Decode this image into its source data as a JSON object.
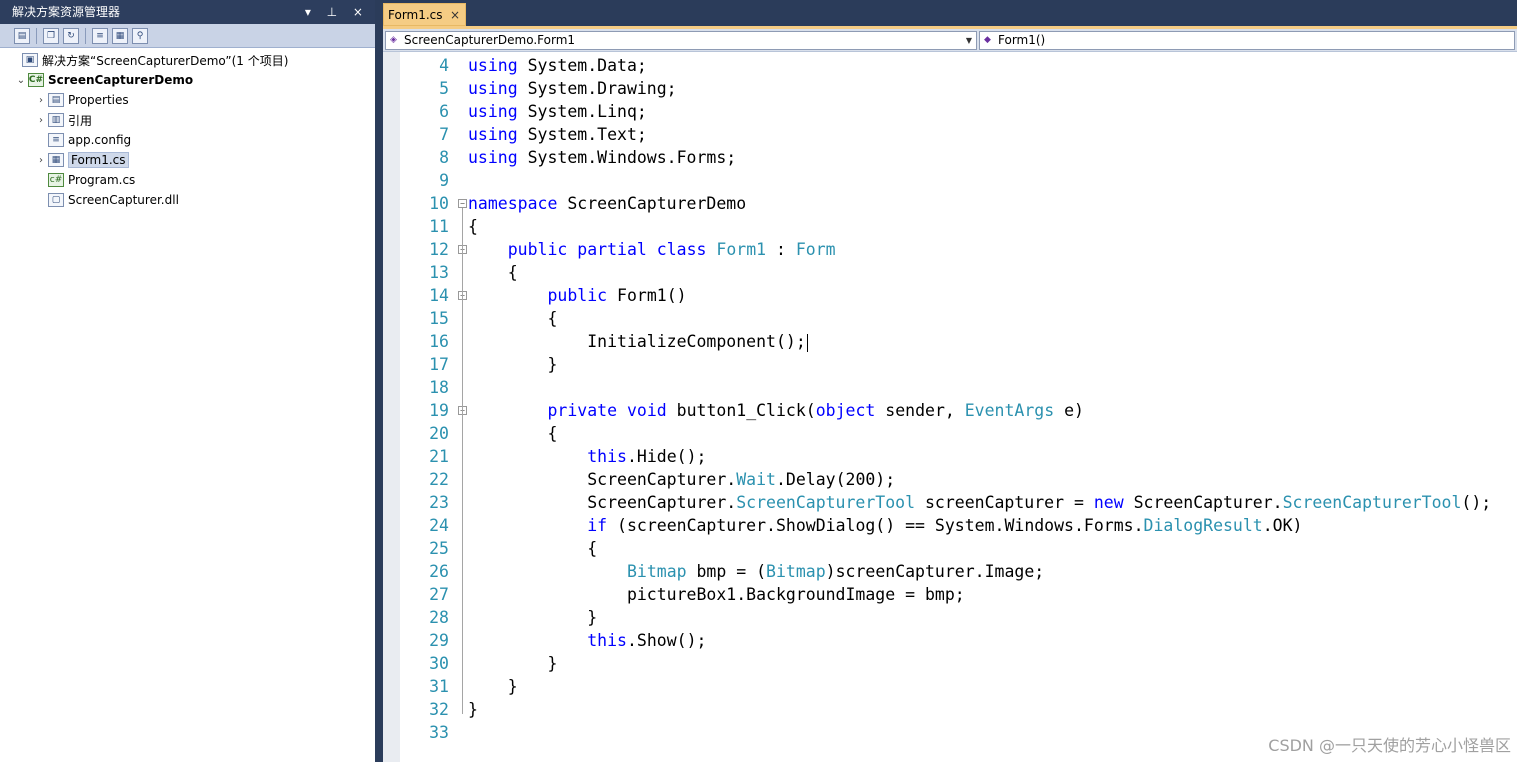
{
  "solution_explorer": {
    "title": "解决方案资源管理器",
    "title_controls": "▾ ⊥ ×",
    "solution_label": "解决方案“ScreenCapturerDemo”(1 个项目)",
    "project_label": "ScreenCapturerDemo",
    "items": [
      {
        "label": "Properties",
        "expandable": true,
        "icon": "properties-icon"
      },
      {
        "label": "引用",
        "expandable": true,
        "icon": "references-icon"
      },
      {
        "label": "app.config",
        "expandable": false,
        "icon": "config-file-icon"
      },
      {
        "label": "Form1.cs",
        "expandable": true,
        "icon": "form-icon",
        "selected": true
      },
      {
        "label": "Program.cs",
        "expandable": false,
        "icon": "csharp-file-icon"
      },
      {
        "label": "ScreenCapturer.dll",
        "expandable": false,
        "icon": "dll-file-icon"
      }
    ]
  },
  "editor": {
    "tab_label": "Form1.cs",
    "tab_close": "×",
    "type_dropdown": "ScreenCapturerDemo.Form1",
    "member_dropdown": "Form1()",
    "lines": [
      {
        "n": "4",
        "segs": [
          [
            "kw",
            "using"
          ],
          [
            "t",
            " System.Data;"
          ]
        ]
      },
      {
        "n": "5",
        "segs": [
          [
            "kw",
            "using"
          ],
          [
            "t",
            " System.Drawing;"
          ]
        ]
      },
      {
        "n": "6",
        "segs": [
          [
            "kw",
            "using"
          ],
          [
            "t",
            " System.Linq;"
          ]
        ]
      },
      {
        "n": "7",
        "segs": [
          [
            "kw",
            "using"
          ],
          [
            "t",
            " System.Text;"
          ]
        ]
      },
      {
        "n": "8",
        "segs": [
          [
            "kw",
            "using"
          ],
          [
            "t",
            " System.Windows.Forms;"
          ]
        ]
      },
      {
        "n": "9",
        "segs": []
      },
      {
        "n": "10",
        "fold": true,
        "segs": [
          [
            "kw",
            "namespace"
          ],
          [
            "t",
            " ScreenCapturerDemo"
          ]
        ]
      },
      {
        "n": "11",
        "segs": [
          [
            "t",
            "{"
          ]
        ]
      },
      {
        "n": "12",
        "fold": true,
        "segs": [
          [
            "t",
            "    "
          ],
          [
            "kw",
            "public"
          ],
          [
            "t",
            " "
          ],
          [
            "kw",
            "partial"
          ],
          [
            "t",
            " "
          ],
          [
            "kw",
            "class"
          ],
          [
            "t",
            " "
          ],
          [
            "ty",
            "Form1"
          ],
          [
            "t",
            " : "
          ],
          [
            "ty",
            "Form"
          ]
        ]
      },
      {
        "n": "13",
        "segs": [
          [
            "t",
            "    {"
          ]
        ]
      },
      {
        "n": "14",
        "fold": true,
        "segs": [
          [
            "t",
            "        "
          ],
          [
            "kw",
            "public"
          ],
          [
            "t",
            " Form1()"
          ]
        ]
      },
      {
        "n": "15",
        "segs": [
          [
            "t",
            "        {"
          ]
        ]
      },
      {
        "n": "16",
        "caret": true,
        "segs": [
          [
            "t",
            "            InitializeComponent();"
          ]
        ]
      },
      {
        "n": "17",
        "segs": [
          [
            "t",
            "        }"
          ]
        ]
      },
      {
        "n": "18",
        "segs": []
      },
      {
        "n": "19",
        "fold": true,
        "segs": [
          [
            "t",
            "        "
          ],
          [
            "kw",
            "private"
          ],
          [
            "t",
            " "
          ],
          [
            "kw",
            "void"
          ],
          [
            "t",
            " button1_Click("
          ],
          [
            "kw",
            "object"
          ],
          [
            "t",
            " sender, "
          ],
          [
            "ty",
            "EventArgs"
          ],
          [
            "t",
            " e)"
          ]
        ]
      },
      {
        "n": "20",
        "segs": [
          [
            "t",
            "        {"
          ]
        ]
      },
      {
        "n": "21",
        "segs": [
          [
            "t",
            "            "
          ],
          [
            "kw",
            "this"
          ],
          [
            "t",
            ".Hide();"
          ]
        ]
      },
      {
        "n": "22",
        "segs": [
          [
            "t",
            "            ScreenCapturer."
          ],
          [
            "ty",
            "Wait"
          ],
          [
            "t",
            ".Delay(200);"
          ]
        ]
      },
      {
        "n": "23",
        "segs": [
          [
            "t",
            "            ScreenCapturer."
          ],
          [
            "ty",
            "ScreenCapturerTool"
          ],
          [
            "t",
            " screenCapturer = "
          ],
          [
            "kw",
            "new"
          ],
          [
            "t",
            " ScreenCapturer."
          ],
          [
            "ty",
            "ScreenCapturerTool"
          ],
          [
            "t",
            "();"
          ]
        ]
      },
      {
        "n": "24",
        "segs": [
          [
            "t",
            "            "
          ],
          [
            "kw",
            "if"
          ],
          [
            "t",
            " (screenCapturer.ShowDialog() == System.Windows.Forms."
          ],
          [
            "ty",
            "DialogResult"
          ],
          [
            "t",
            ".OK)"
          ]
        ]
      },
      {
        "n": "25",
        "segs": [
          [
            "t",
            "            {"
          ]
        ]
      },
      {
        "n": "26",
        "segs": [
          [
            "t",
            "                "
          ],
          [
            "ty",
            "Bitmap"
          ],
          [
            "t",
            " bmp = ("
          ],
          [
            "ty",
            "Bitmap"
          ],
          [
            "t",
            ")screenCapturer.Image;"
          ]
        ]
      },
      {
        "n": "27",
        "segs": [
          [
            "t",
            "                pictureBox1.BackgroundImage = bmp;"
          ]
        ]
      },
      {
        "n": "28",
        "segs": [
          [
            "t",
            "            }"
          ]
        ]
      },
      {
        "n": "29",
        "segs": [
          [
            "t",
            "            "
          ],
          [
            "kw",
            "this"
          ],
          [
            "t",
            ".Show();"
          ]
        ]
      },
      {
        "n": "30",
        "segs": [
          [
            "t",
            "        }"
          ]
        ]
      },
      {
        "n": "31",
        "segs": [
          [
            "t",
            "    }"
          ]
        ]
      },
      {
        "n": "32",
        "segs": [
          [
            "t",
            "}"
          ]
        ]
      },
      {
        "n": "33",
        "segs": []
      }
    ]
  },
  "watermark": "CSDN @一只天使的芳心小怪兽区",
  "colors": {
    "keyword": "#0000ff",
    "type": "#2b91af",
    "line_number": "#2b91af",
    "tab_active": "#f5cc84",
    "chrome": "#2b3c5a"
  }
}
